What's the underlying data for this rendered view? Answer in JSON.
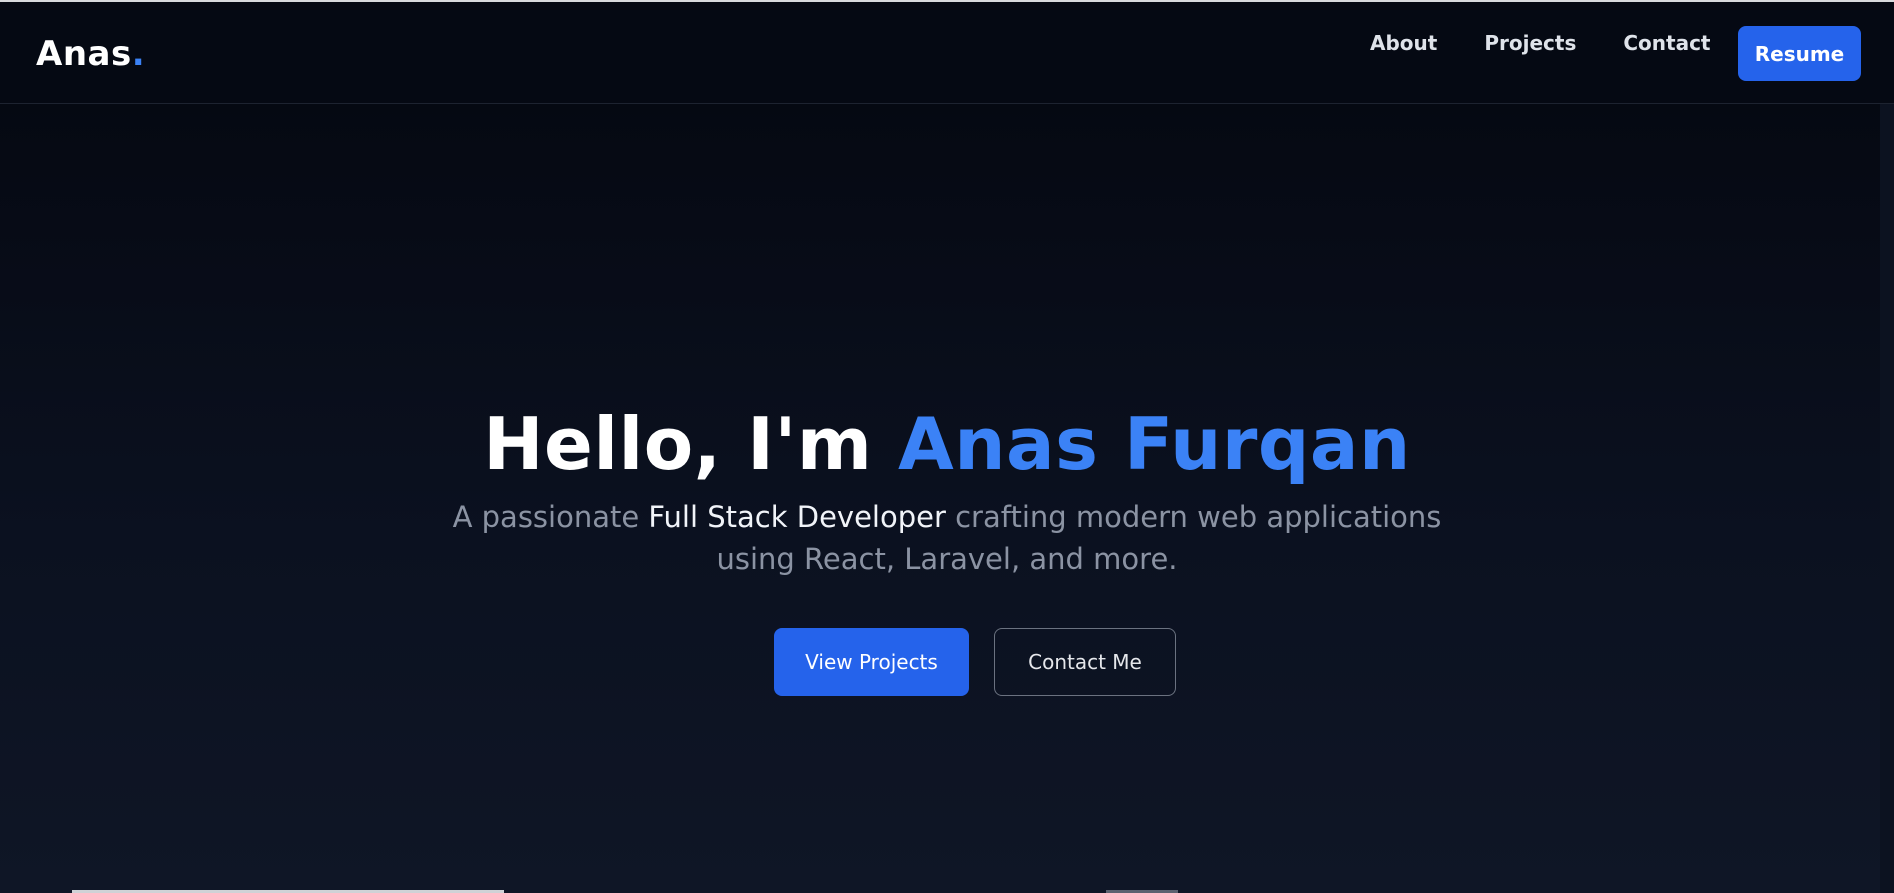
{
  "brand": {
    "name": "Anas",
    "dot": ".",
    "accent_color": "#3b82f6"
  },
  "nav": {
    "links": [
      {
        "label": "About"
      },
      {
        "label": "Projects"
      },
      {
        "label": "Contact"
      }
    ],
    "resume_label": "Resume"
  },
  "hero": {
    "greeting": "Hello, I'm ",
    "name": "Anas Furqan",
    "subtitle_prefix": "A passionate ",
    "subtitle_highlight": "Full Stack Developer",
    "subtitle_suffix": " crafting modern web applications using React, Laravel, and more.",
    "primary_cta": "View Projects",
    "secondary_cta": "Contact Me"
  },
  "colors": {
    "background": "#050912",
    "primary": "#2563eb",
    "text": "#ffffff",
    "muted": "#8b93a3"
  }
}
